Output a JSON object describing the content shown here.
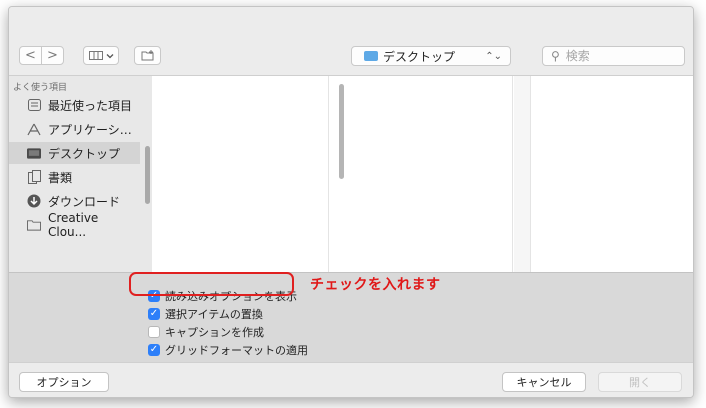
{
  "sidebar": {
    "heading": "よく使う項目",
    "items": [
      {
        "label": "最近使った項目",
        "icon": "recents-icon"
      },
      {
        "label": "アプリケーシ…",
        "icon": "applications-icon"
      },
      {
        "label": "デスクトップ",
        "icon": "desktop-icon",
        "selected": true
      },
      {
        "label": "書類",
        "icon": "documents-icon"
      },
      {
        "label": "ダウンロード",
        "icon": "downloads-icon"
      },
      {
        "label": "Creative Clou...",
        "icon": "folder-icon"
      }
    ]
  },
  "toolbar": {
    "back": "<",
    "forward": ">",
    "location": "デスクトップ",
    "search_placeholder": "検索"
  },
  "options": [
    {
      "label": "読み込みオプションを表示",
      "checked": true
    },
    {
      "label": "選択アイテムの置換",
      "checked": true
    },
    {
      "label": "キャプションを作成",
      "checked": false
    },
    {
      "label": "グリッドフォーマットの適用",
      "checked": true
    }
  ],
  "annotation": "チェックを入れます",
  "buttons": {
    "options": "オプション",
    "cancel": "キャンセル",
    "open": "開く"
  },
  "colors": {
    "accent": "#2d7ff9",
    "annotation": "#e01818"
  }
}
